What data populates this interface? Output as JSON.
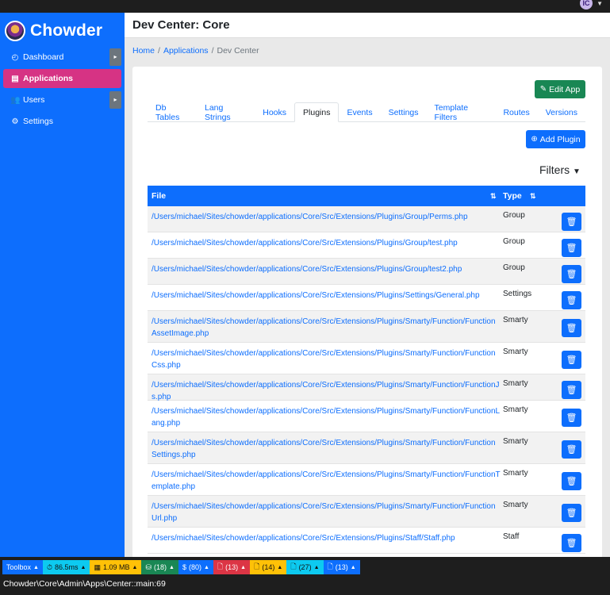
{
  "topbar": {
    "avatar": "IC"
  },
  "sidebar": {
    "brand": "Chowder",
    "items": [
      {
        "label": "Dashboard",
        "icon": "gauge-icon",
        "glyph": "◴",
        "toggle": true,
        "active": false
      },
      {
        "label": "Applications",
        "icon": "window-icon",
        "glyph": "▤",
        "toggle": false,
        "active": true
      },
      {
        "label": "Users",
        "icon": "users-icon",
        "glyph": "👥",
        "toggle": true,
        "active": false
      },
      {
        "label": "Settings",
        "icon": "gear-icon",
        "glyph": "⚙",
        "toggle": false,
        "active": false
      }
    ]
  },
  "header": {
    "title": "Dev Center: Core"
  },
  "breadcrumb": {
    "home": "Home",
    "applications": "Applications",
    "current": "Dev Center"
  },
  "buttons": {
    "edit_app": "Edit App",
    "add_plugin": "Add Plugin"
  },
  "tabs": [
    {
      "label": "Db Tables",
      "active": false
    },
    {
      "label": "Lang Strings",
      "active": false
    },
    {
      "label": "Hooks",
      "active": false
    },
    {
      "label": "Plugins",
      "active": true
    },
    {
      "label": "Events",
      "active": false
    },
    {
      "label": "Settings",
      "active": false
    },
    {
      "label": "Template Filters",
      "active": false
    },
    {
      "label": "Routes",
      "active": false
    },
    {
      "label": "Versions",
      "active": false
    }
  ],
  "filters_label": "Filters",
  "table": {
    "columns": [
      "File",
      "Type"
    ],
    "rows": [
      {
        "file": "/Users/michael/Sites/chowder/applications/Core/Src/Extensions/Plugins/Group/Perms.php",
        "type": "Group"
      },
      {
        "file": "/Users/michael/Sites/chowder/applications/Core/Src/Extensions/Plugins/Group/test.php",
        "type": "Group"
      },
      {
        "file": "/Users/michael/Sites/chowder/applications/Core/Src/Extensions/Plugins/Group/test2.php",
        "type": "Group"
      },
      {
        "file": "/Users/michael/Sites/chowder/applications/Core/Src/Extensions/Plugins/Settings/General.php",
        "type": "Settings"
      },
      {
        "file": "/Users/michael/Sites/chowder/applications/Core/Src/Extensions/Plugins/Smarty/Function/FunctionAssetImage.php",
        "type": "Smarty"
      },
      {
        "file": "/Users/michael/Sites/chowder/applications/Core/Src/Extensions/Plugins/Smarty/Function/FunctionCss.php",
        "type": "Smarty"
      },
      {
        "file": "/Users/michael/Sites/chowder/applications/Core/Src/Extensions/Plugins/Smarty/Function/FunctionJs.php",
        "type": "Smarty"
      },
      {
        "file": "/Users/michael/Sites/chowder/applications/Core/Src/Extensions/Plugins/Smarty/Function/FunctionLang.php",
        "type": "Smarty"
      },
      {
        "file": "/Users/michael/Sites/chowder/applications/Core/Src/Extensions/Plugins/Smarty/Function/FunctionSettings.php",
        "type": "Smarty"
      },
      {
        "file": "/Users/michael/Sites/chowder/applications/Core/Src/Extensions/Plugins/Smarty/Function/FunctionTemplate.php",
        "type": "Smarty"
      },
      {
        "file": "/Users/michael/Sites/chowder/applications/Core/Src/Extensions/Plugins/Smarty/Function/FunctionUrl.php",
        "type": "Smarty"
      },
      {
        "file": "/Users/michael/Sites/chowder/applications/Core/Src/Extensions/Plugins/Staff/Staff.php",
        "type": "Staff"
      }
    ]
  },
  "toolbox": {
    "items": [
      {
        "name": "toolbox-toggle",
        "label": "Toolbox",
        "glyph": "",
        "color": "#0d6efd",
        "dark": false
      },
      {
        "name": "time-badge",
        "label": "86.5ms",
        "glyph": "⏱",
        "color": "#0dcaf0",
        "dark": true
      },
      {
        "name": "memory-badge",
        "label": "1.09 MB",
        "glyph": "▦",
        "color": "#ffc107",
        "dark": true
      },
      {
        "name": "queries-badge",
        "label": "(18)",
        "glyph": "⛁",
        "color": "#198754",
        "dark": false
      },
      {
        "name": "cache-badge",
        "label": "(80)",
        "glyph": "$",
        "color": "#0d6efd",
        "dark": false
      },
      {
        "name": "errors-badge",
        "label": "(13)",
        "glyph": "🗋",
        "color": "#dc3545",
        "dark": false
      },
      {
        "name": "warnings-badge",
        "label": "(14)",
        "glyph": "🗋",
        "color": "#ffc107",
        "dark": true
      },
      {
        "name": "files-badge",
        "label": "(27)",
        "glyph": "🗋",
        "color": "#0dcaf0",
        "dark": true
      },
      {
        "name": "logs-badge",
        "label": "(13)",
        "glyph": "🗋",
        "color": "#0d6efd",
        "dark": false
      }
    ],
    "route": "Chowder\\Core\\Admin\\Apps\\Center::main:69"
  }
}
